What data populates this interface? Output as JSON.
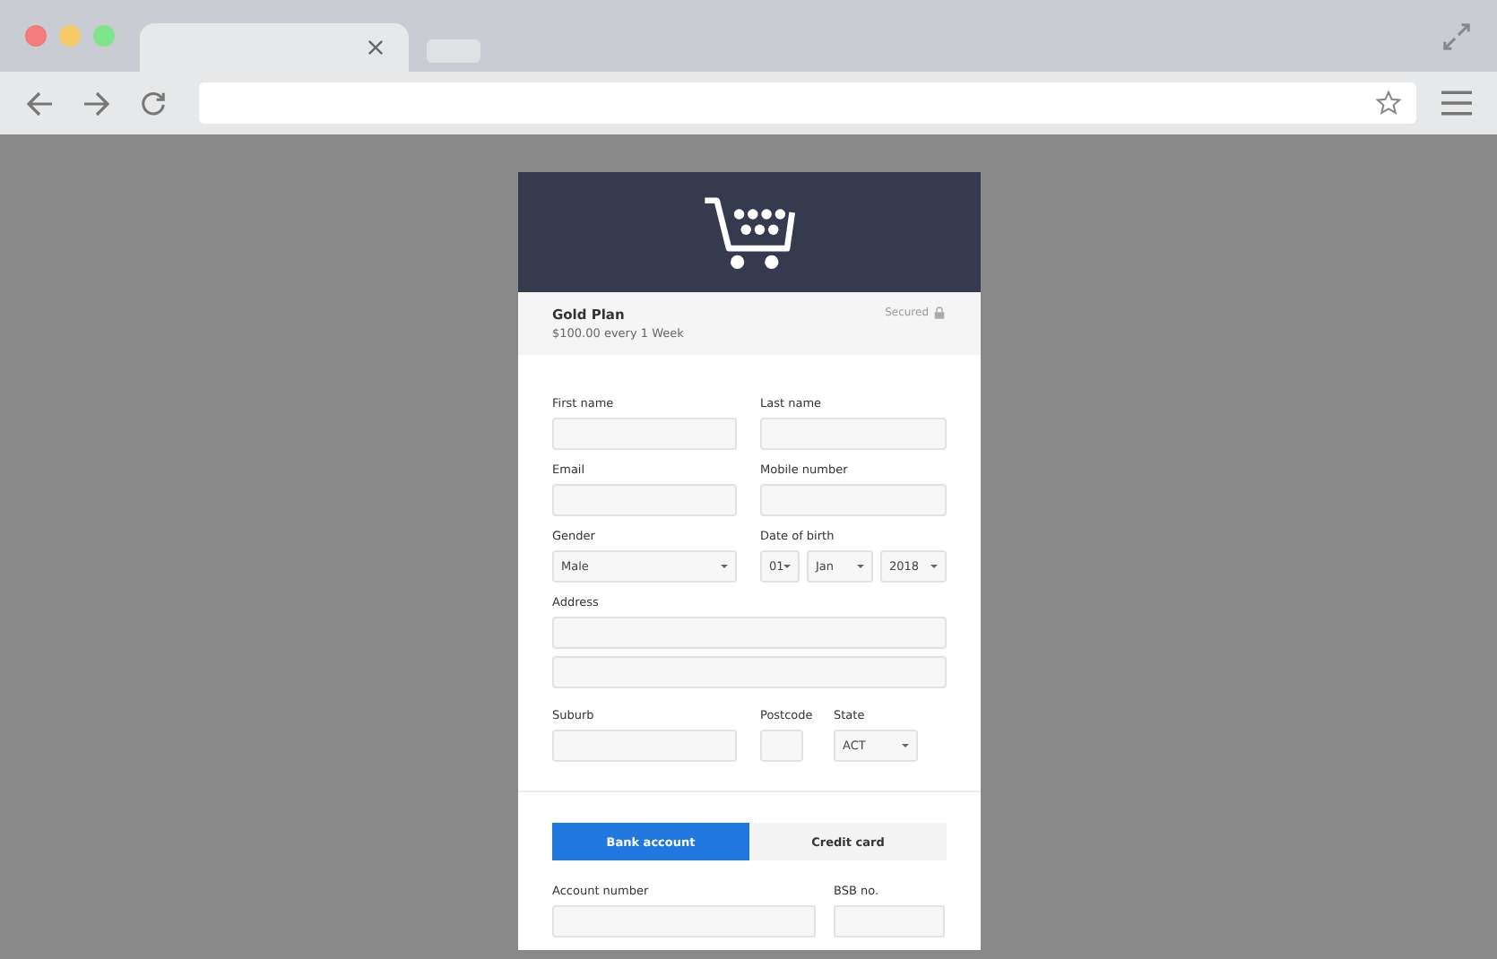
{
  "plan": {
    "name": "Gold Plan",
    "price": "$100.00 every 1 Week",
    "secured": "Secured"
  },
  "rows": [
    {
      "kind": "pair",
      "fields": [
        {
          "label": "First name",
          "kind": "text"
        },
        {
          "label": "Last name",
          "kind": "text"
        }
      ]
    },
    {
      "kind": "pair",
      "fields": [
        {
          "label": "Email",
          "kind": "text"
        },
        {
          "label": "Mobile number",
          "kind": "text"
        }
      ]
    },
    {
      "kind": "pair",
      "fields": [
        {
          "label": "Gender",
          "kind": "select",
          "value": "Male"
        },
        {
          "label": "Date of birth",
          "kind": "date",
          "parts": [
            "01",
            "Jan",
            "2018"
          ]
        }
      ]
    },
    {
      "kind": "single",
      "fields": [
        {
          "label": "Address",
          "kind": "multi",
          "inputs": [
            {
              "kind": "text"
            },
            {
              "kind": "text"
            }
          ]
        }
      ]
    },
    {
      "kind": "locality",
      "fields": [
        {
          "label": "Suburb",
          "kind": "text"
        },
        {
          "label": "Postcode",
          "kind": "text"
        },
        {
          "label": "State",
          "kind": "select",
          "value": "ACT"
        }
      ]
    }
  ],
  "payment_tabs": [
    {
      "label": "Bank account",
      "selected": true
    },
    {
      "label": "Credit card",
      "selected": false
    }
  ],
  "payment_rows": [
    {
      "kind": "account",
      "fields": [
        {
          "label": "Account number",
          "kind": "text"
        },
        {
          "label": "BSB no.",
          "kind": "text"
        }
      ]
    }
  ]
}
